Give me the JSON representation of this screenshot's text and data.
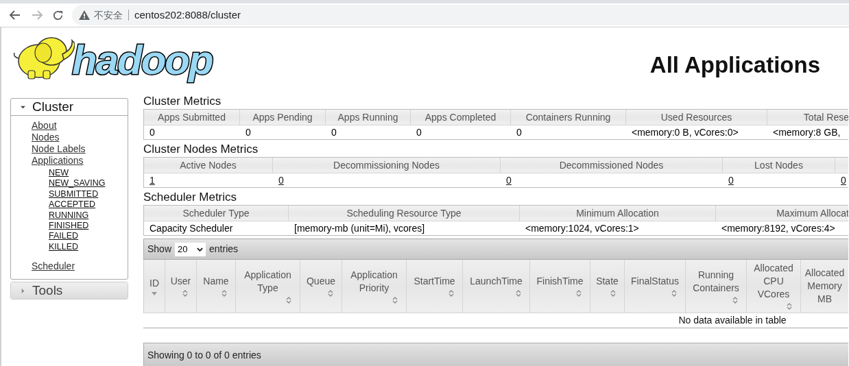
{
  "browser": {
    "security_label": "不安全",
    "url": "centos202:8088/cluster"
  },
  "logo": {
    "text": "hadoop"
  },
  "page_title": "All Applications",
  "sidebar": [
    {
      "title": "Cluster",
      "expanded": true,
      "items": [
        {
          "label": "About"
        },
        {
          "label": "Nodes"
        },
        {
          "label": "Node Labels"
        },
        {
          "label": "Applications",
          "children": [
            {
              "label": "NEW"
            },
            {
              "label": "NEW_SAVING"
            },
            {
              "label": "SUBMITTED"
            },
            {
              "label": "ACCEPTED"
            },
            {
              "label": "RUNNING"
            },
            {
              "label": "FINISHED"
            },
            {
              "label": "FAILED"
            },
            {
              "label": "KILLED"
            }
          ]
        },
        {
          "label": "Scheduler"
        }
      ]
    },
    {
      "title": "Tools",
      "expanded": false
    }
  ],
  "cluster_metrics": {
    "title": "Cluster Metrics",
    "columns": [
      "Apps Submitted",
      "Apps Pending",
      "Apps Running",
      "Apps Completed",
      "Containers Running",
      "Used Resources",
      "Total Rese"
    ],
    "values": [
      "0",
      "0",
      "0",
      "0",
      "0",
      "<memory:0 B, vCores:0>",
      "<memory:8 GB,"
    ]
  },
  "nodes_metrics": {
    "title": "Cluster Nodes Metrics",
    "columns": [
      "Active Nodes",
      "Decommissioning Nodes",
      "Decommissioned Nodes",
      "Lost Nodes"
    ],
    "values": [
      "1",
      "0",
      "0",
      "0",
      "0"
    ]
  },
  "scheduler_metrics": {
    "title": "Scheduler Metrics",
    "columns": [
      "Scheduler Type",
      "Scheduling Resource Type",
      "Minimum Allocation",
      "Maximum Allocat"
    ],
    "values": [
      "Capacity Scheduler",
      "[memory-mb (unit=Mi), vcores]",
      "<memory:1024, vCores:1>",
      "<memory:8192, vCores:4>"
    ]
  },
  "apps_table": {
    "show_label": "Show",
    "page_length": "20",
    "entries_label": "entries",
    "columns": [
      {
        "label": "ID",
        "sorted": true
      },
      {
        "label": "User",
        "sorted": false
      },
      {
        "label": "Name",
        "sorted": false
      },
      {
        "label": "Application Type",
        "sorted": false
      },
      {
        "label": "Queue",
        "sorted": false
      },
      {
        "label": "Application Priority",
        "sorted": false
      },
      {
        "label": "StartTime",
        "sorted": false
      },
      {
        "label": "LaunchTime",
        "sorted": false
      },
      {
        "label": "FinishTime",
        "sorted": false
      },
      {
        "label": "State",
        "sorted": false
      },
      {
        "label": "FinalStatus",
        "sorted": false
      },
      {
        "label": "Running Containers",
        "sorted": false
      },
      {
        "label": "Allocated CPU VCores",
        "sorted": false
      },
      {
        "label": "Allocated Memory MB"
      }
    ],
    "empty_message": "No data available in table",
    "info": "Showing 0 to 0 of 0 entries"
  }
}
